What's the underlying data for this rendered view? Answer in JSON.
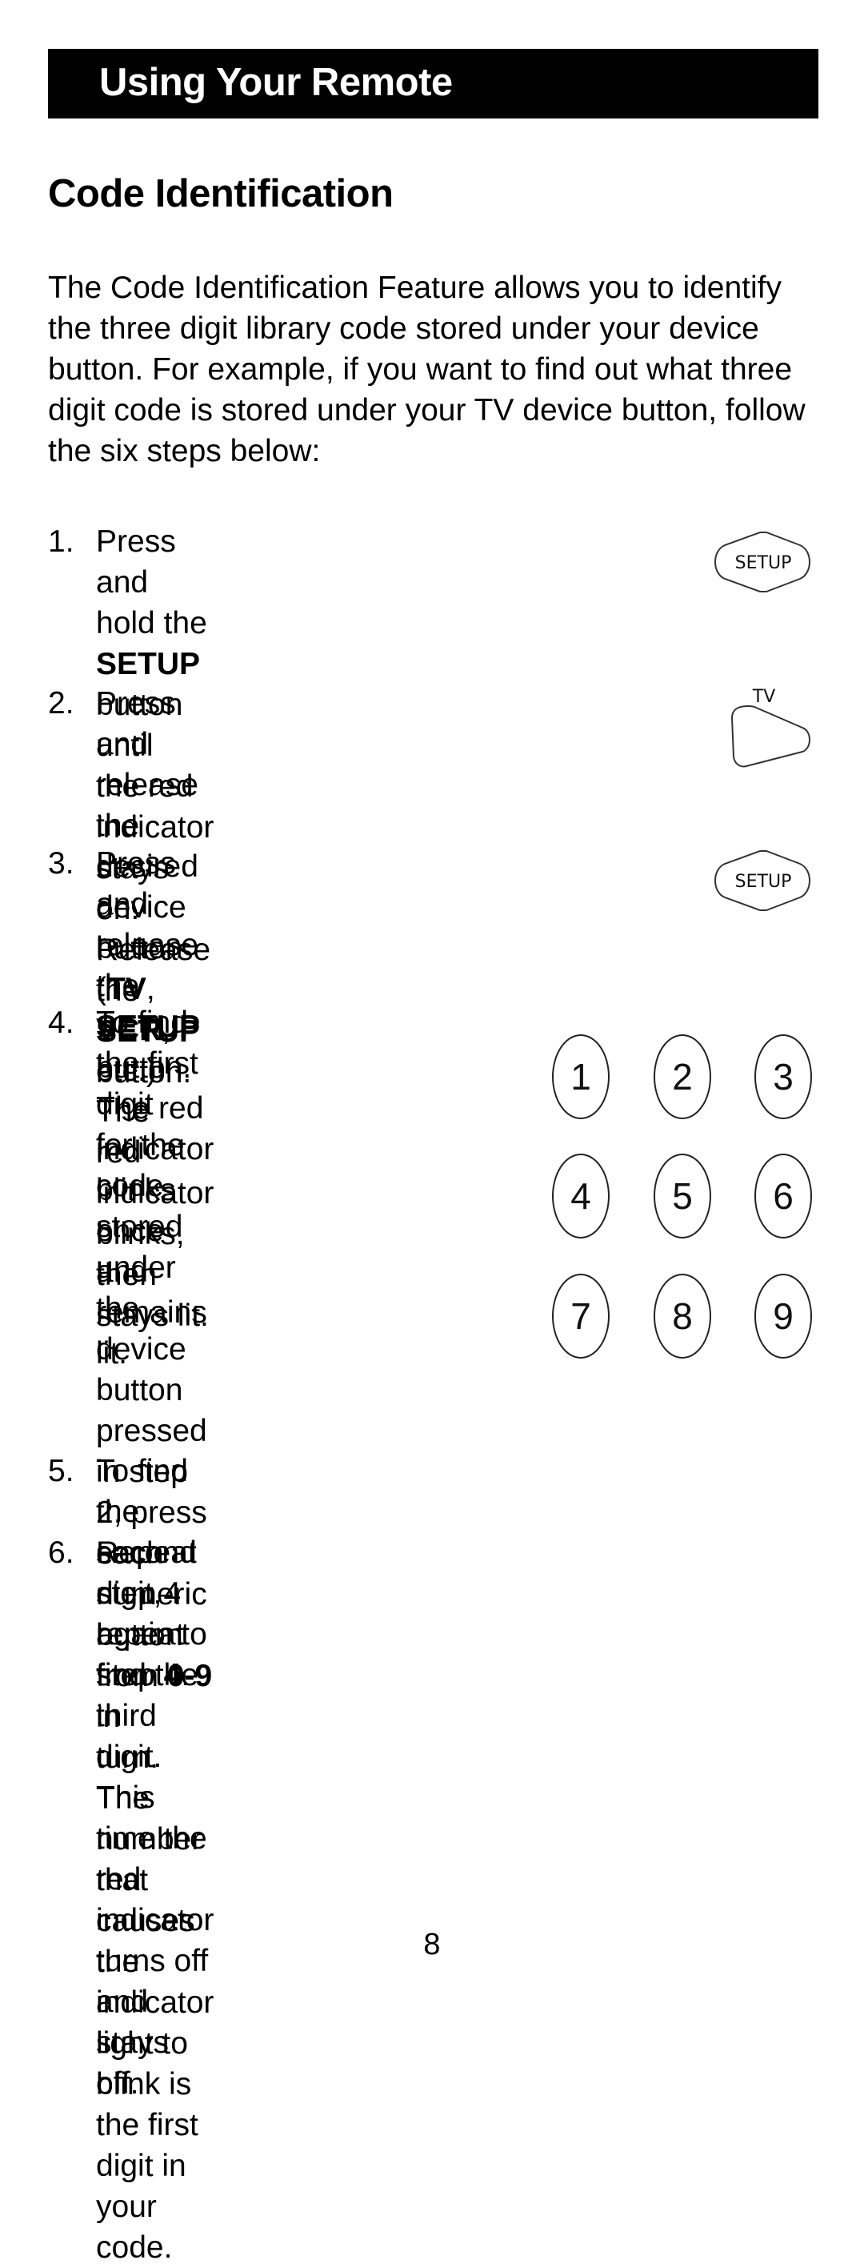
{
  "header": {
    "title": "Using Your Remote"
  },
  "section_title": "Code Identification",
  "intro": "The Code Identification Feature allows you to identify the three digit library code stored under your device button. For example, if you want to find out what three digit code is stored under your TV device button, follow the six steps below:",
  "steps": [
    {
      "number": "1.",
      "lines": [
        [
          {
            "t": "Press and hold the "
          },
          {
            "t": "SETUP",
            "b": true
          },
          {
            "t": " button until"
          }
        ],
        [
          {
            "t": "the red indicator stays on. Release the"
          }
        ],
        [
          {
            "t": "SETUP",
            "b": true
          },
          {
            "t": " button."
          }
        ]
      ],
      "icon": {
        "name": "setup-button-icon",
        "label": "SETUP"
      }
    },
    {
      "number": "2.",
      "lines": [
        [
          {
            "t": "Press and release the desired"
          }
        ],
        [
          {
            "t": "device button ("
          },
          {
            "t": "TV",
            "b": true
          },
          {
            "t": ", "
          },
          {
            "t": "VCR",
            "b": true
          },
          {
            "t": ", etc.). The"
          }
        ],
        [
          {
            "t": "red indicator blinks, then stays lit."
          }
        ]
      ],
      "icon": {
        "name": "tv-button-icon",
        "label": "TV"
      }
    },
    {
      "number": "3.",
      "lines": [
        [
          {
            "t": "Press and release the "
          },
          {
            "t": "SETUP",
            "b": true
          },
          {
            "t": " button."
          }
        ],
        [
          {
            "t": "The red indicator blinks once and"
          }
        ],
        [
          {
            "t": "remains lit."
          }
        ]
      ],
      "icon": {
        "name": "setup-button-icon",
        "label": "SETUP"
      }
    },
    {
      "number": "4.",
      "lines": [
        [
          {
            "t": "To find the first digit"
          }
        ],
        [
          {
            "t": "for the code stored"
          }
        ],
        [
          {
            "t": "under the device"
          }
        ],
        [
          {
            "t": "button pressed in step"
          }
        ],
        [
          {
            "t": "2, press each numeric"
          }
        ],
        [
          {
            "t": "button from "
          },
          {
            "t": "0-9",
            "b": true
          },
          {
            "t": " in"
          }
        ],
        [
          {
            "t": "turn. The number that"
          }
        ],
        [
          {
            "t": "causes the indicator"
          }
        ],
        [
          {
            "t": "light to blink is the first"
          }
        ],
        [
          {
            "t": "digit in your code."
          }
        ]
      ]
    },
    {
      "number": "5.",
      "lines": [
        [
          {
            "t": "To find the second digit, repeat step "
          },
          {
            "t": "4",
            "b": true
          },
          {
            "t": "."
          }
        ]
      ]
    },
    {
      "number": "6.",
      "lines": [
        [
          {
            "t": "Repeat step 4 again to find the third digit. This"
          }
        ],
        [
          {
            "t": "time the red indicator turns off and stays off."
          }
        ]
      ]
    }
  ],
  "keypad": {
    "keys": [
      "1",
      "2",
      "3",
      "4",
      "5",
      "6",
      "7",
      "8",
      "9"
    ]
  },
  "page_number": "8"
}
